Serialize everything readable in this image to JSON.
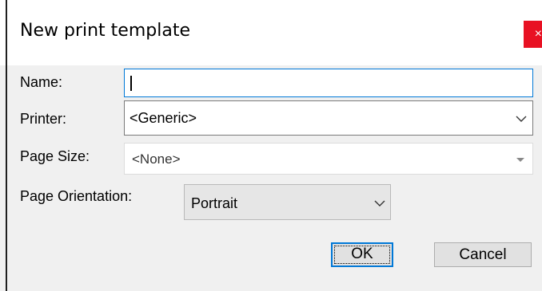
{
  "dialog": {
    "title": "New print template",
    "close_glyph": "×"
  },
  "form": {
    "name": {
      "label": "Name:",
      "value": ""
    },
    "printer": {
      "label": "Printer:",
      "value": "<Generic>"
    },
    "page_size": {
      "label": "Page Size:",
      "value": "<None>"
    },
    "page_orientation": {
      "label": "Page Orientation:",
      "value": "Portrait"
    }
  },
  "buttons": {
    "ok_label": "OK",
    "cancel_label": "Cancel"
  },
  "icons": {
    "dropdown": "chevron-down-icon",
    "close": "close-icon"
  },
  "colors": {
    "focus_accent": "#0078d7",
    "close_button": "#e81123"
  }
}
